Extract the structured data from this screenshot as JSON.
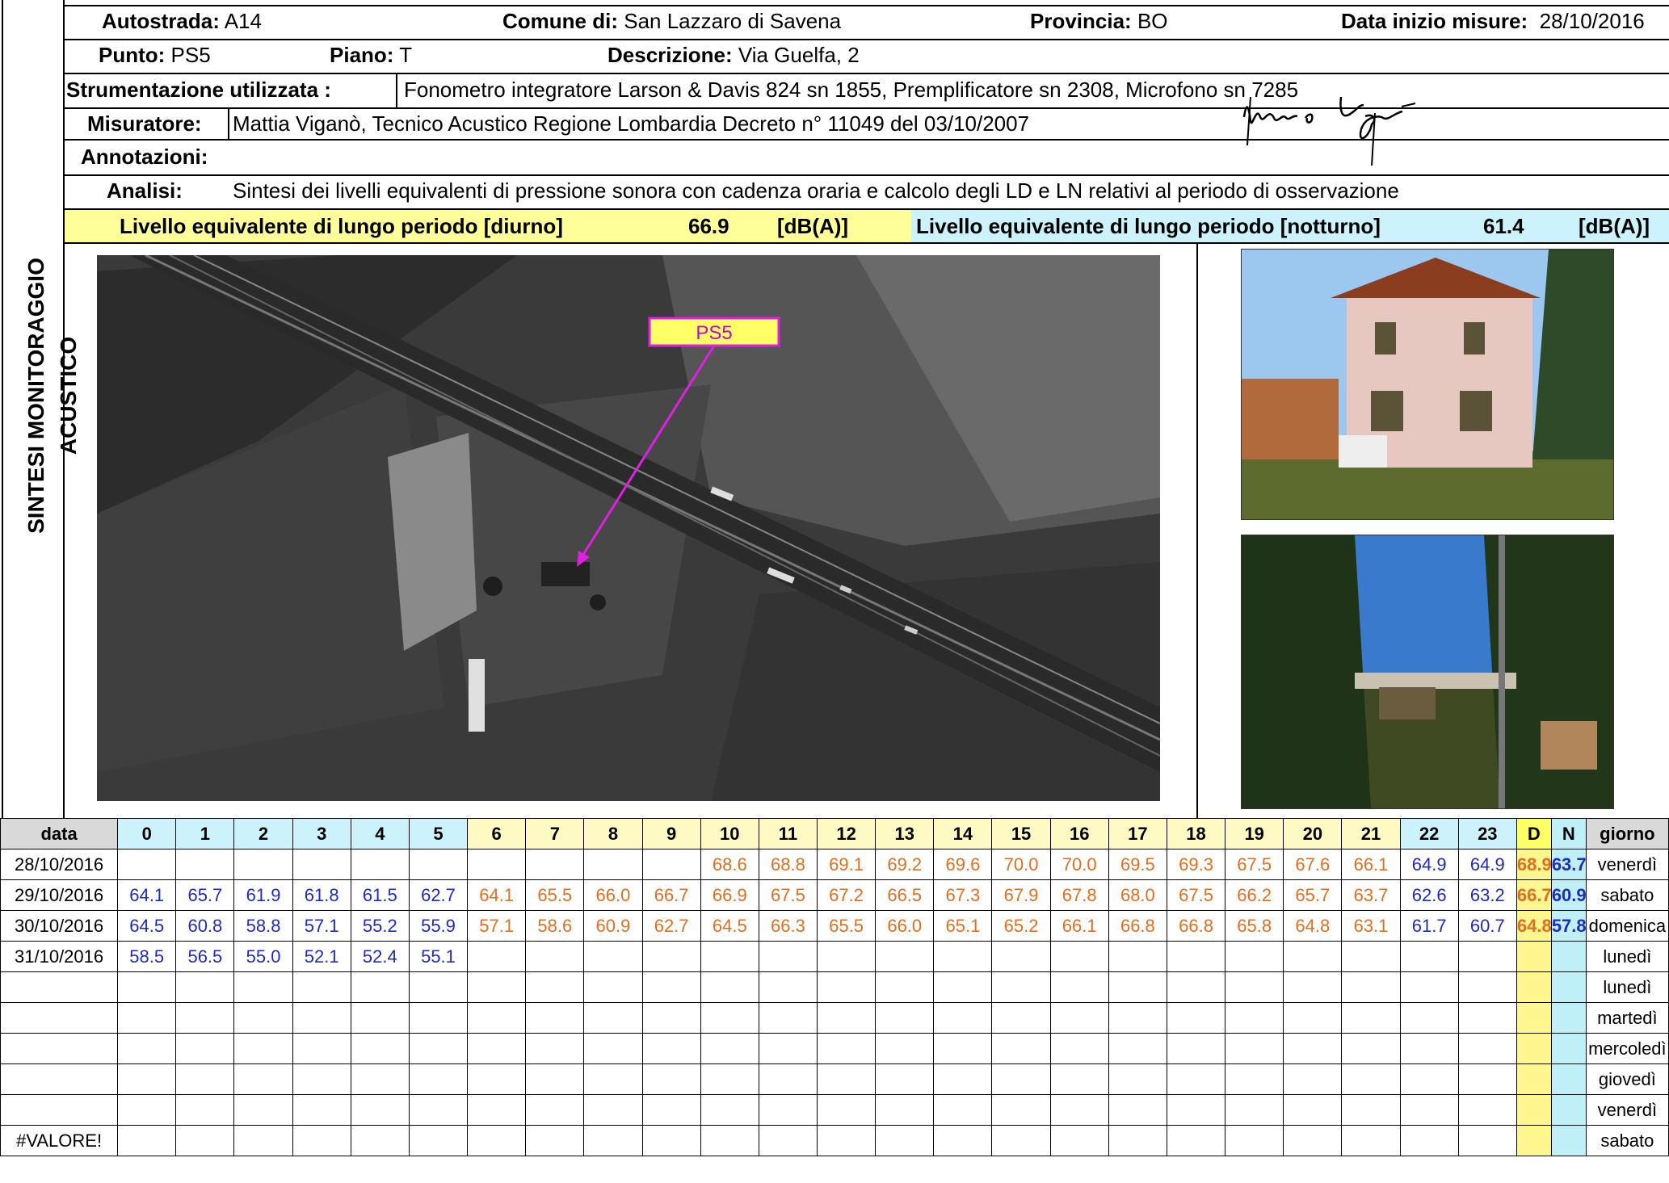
{
  "side_title": "SINTESI MONITORAGGIO ACUSTICO",
  "header": {
    "autostrada_label": "Autostrada:",
    "autostrada": "A14",
    "comune_label": "Comune di:",
    "comune": "San Lazzaro di Savena",
    "provincia_label": "Provincia:",
    "provincia": "BO",
    "data_label": "Data inizio misure:",
    "data": "28/10/2016",
    "punto_label": "Punto:",
    "punto": "PS5",
    "piano_label": "Piano:",
    "piano": "T",
    "descrizione_label": "Descrizione:",
    "descrizione": "Via Guelfa, 2",
    "strumentazione_label": "Strumentazione utilizzata :",
    "strumentazione": "Fonometro integratore Larson & Davis 824 sn 1855, Premplificatore sn 2308, Microfono sn 7285",
    "misuratore_label": "Misuratore:",
    "misuratore": "Mattia Viganò, Tecnico Acustico Regione Lombardia Decreto n° 11049 del 03/10/2007",
    "annotazioni_label": "Annotazioni:",
    "analisi_label": "Analisi:",
    "analisi": "Sintesi dei livelli equivalenti di pressione sonora con cadenza oraria e calcolo degli LD e LN relativi al periodo di osservazione"
  },
  "levels": {
    "diurno_label": "Livello equivalente di lungo periodo [diurno]",
    "diurno_value": "66.9",
    "notturno_label": "Livello equivalente di lungo periodo [notturno]",
    "notturno_value": "61.4",
    "unit": "[dB(A)]"
  },
  "map": {
    "point_label": "PS5"
  },
  "table": {
    "date_header": "data",
    "hours": [
      "0",
      "1",
      "2",
      "3",
      "4",
      "5",
      "6",
      "7",
      "8",
      "9",
      "10",
      "11",
      "12",
      "13",
      "14",
      "15",
      "16",
      "17",
      "18",
      "19",
      "20",
      "21",
      "22",
      "23"
    ],
    "d_header": "D",
    "n_header": "N",
    "day_header": "giorno",
    "rows": [
      {
        "date": "28/10/2016",
        "values": [
          "",
          "",
          "",
          "",
          "",
          "",
          "",
          "",
          "",
          "",
          "68.6",
          "68.8",
          "69.1",
          "69.2",
          "69.6",
          "70.0",
          "70.0",
          "69.5",
          "69.3",
          "67.5",
          "67.6",
          "66.1",
          "64.9",
          "64.9"
        ],
        "d": "68.9",
        "n": "63.7",
        "day": "venerdì"
      },
      {
        "date": "29/10/2016",
        "values": [
          "64.1",
          "65.7",
          "61.9",
          "61.8",
          "61.5",
          "62.7",
          "64.1",
          "65.5",
          "66.0",
          "66.7",
          "66.9",
          "67.5",
          "67.2",
          "66.5",
          "67.3",
          "67.9",
          "67.8",
          "68.0",
          "67.5",
          "66.2",
          "65.7",
          "63.7",
          "62.6",
          "63.2"
        ],
        "d": "66.7",
        "n": "60.9",
        "day": "sabato"
      },
      {
        "date": "30/10/2016",
        "values": [
          "64.5",
          "60.8",
          "58.8",
          "57.1",
          "55.2",
          "55.9",
          "57.1",
          "58.6",
          "60.9",
          "62.7",
          "64.5",
          "66.3",
          "65.5",
          "66.0",
          "65.1",
          "65.2",
          "66.1",
          "66.8",
          "66.8",
          "65.8",
          "64.8",
          "63.1",
          "61.7",
          "60.7"
        ],
        "d": "64.8",
        "n": "57.8",
        "day": "domenica"
      },
      {
        "date": "31/10/2016",
        "values": [
          "58.5",
          "56.5",
          "55.0",
          "52.1",
          "52.4",
          "55.1",
          "",
          "",
          "",
          "",
          "",
          "",
          "",
          "",
          "",
          "",
          "",
          "",
          "",
          "",
          "",
          "",
          "",
          ""
        ],
        "d": "",
        "n": "",
        "day": "lunedì"
      },
      {
        "date": "",
        "values": [
          "",
          "",
          "",
          "",
          "",
          "",
          "",
          "",
          "",
          "",
          "",
          "",
          "",
          "",
          "",
          "",
          "",
          "",
          "",
          "",
          "",
          "",
          "",
          ""
        ],
        "d": "",
        "n": "",
        "day": "lunedì"
      },
      {
        "date": "",
        "values": [
          "",
          "",
          "",
          "",
          "",
          "",
          "",
          "",
          "",
          "",
          "",
          "",
          "",
          "",
          "",
          "",
          "",
          "",
          "",
          "",
          "",
          "",
          "",
          ""
        ],
        "d": "",
        "n": "",
        "day": "martedì"
      },
      {
        "date": "",
        "values": [
          "",
          "",
          "",
          "",
          "",
          "",
          "",
          "",
          "",
          "",
          "",
          "",
          "",
          "",
          "",
          "",
          "",
          "",
          "",
          "",
          "",
          "",
          "",
          ""
        ],
        "d": "",
        "n": "",
        "day": "mercoledì"
      },
      {
        "date": "",
        "values": [
          "",
          "",
          "",
          "",
          "",
          "",
          "",
          "",
          "",
          "",
          "",
          "",
          "",
          "",
          "",
          "",
          "",
          "",
          "",
          "",
          "",
          "",
          "",
          ""
        ],
        "d": "",
        "n": "",
        "day": "giovedì"
      },
      {
        "date": "",
        "values": [
          "",
          "",
          "",
          "",
          "",
          "",
          "",
          "",
          "",
          "",
          "",
          "",
          "",
          "",
          "",
          "",
          "",
          "",
          "",
          "",
          "",
          "",
          "",
          ""
        ],
        "d": "",
        "n": "",
        "day": "venerdì"
      },
      {
        "date": "#VALORE!",
        "values": [
          "",
          "",
          "",
          "",
          "",
          "",
          "",
          "",
          "",
          "",
          "",
          "",
          "",
          "",
          "",
          "",
          "",
          "",
          "",
          "",
          "",
          "",
          "",
          ""
        ],
        "d": "",
        "n": "",
        "day": "sabato"
      }
    ]
  }
}
